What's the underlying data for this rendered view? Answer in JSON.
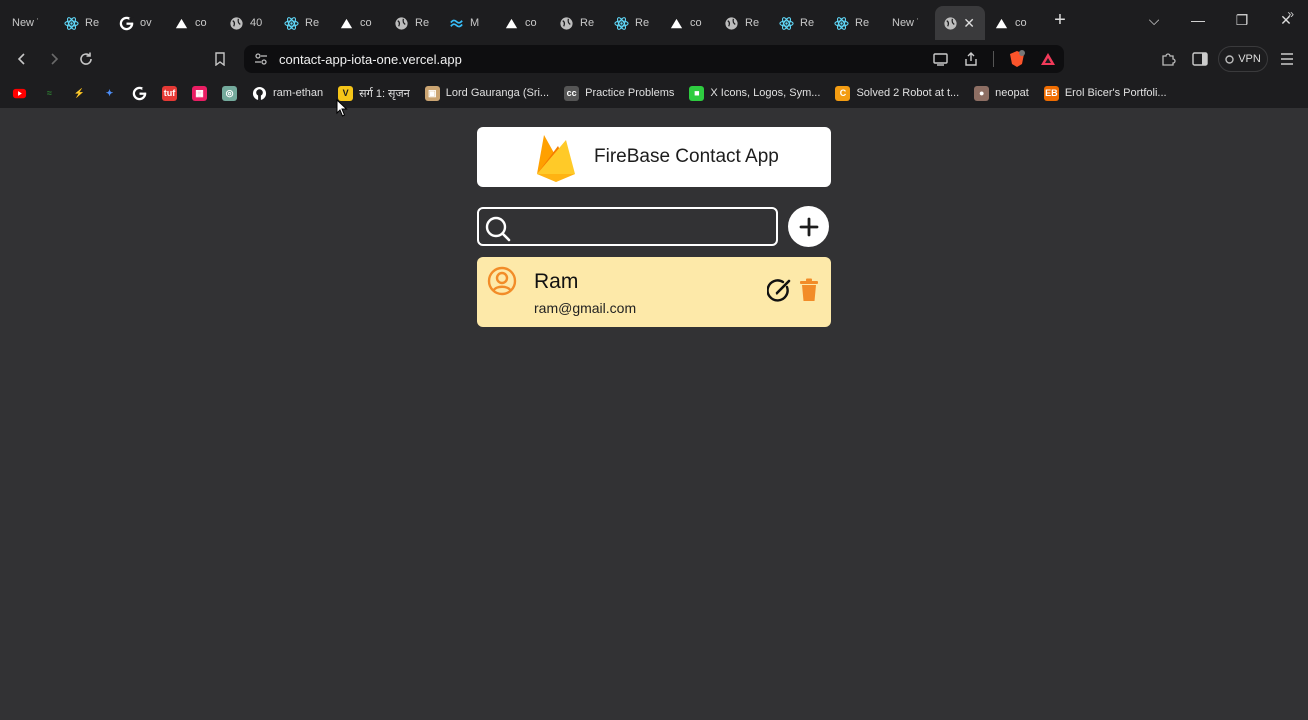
{
  "browser": {
    "tabs": [
      {
        "label": "New Ta",
        "icon": "none"
      },
      {
        "label": "Re",
        "icon": "react-icon"
      },
      {
        "label": "ov",
        "icon": "google-icon"
      },
      {
        "label": "co",
        "icon": "vercel-icon"
      },
      {
        "label": "40",
        "icon": "globe-icon"
      },
      {
        "label": "Re",
        "icon": "react-icon"
      },
      {
        "label": "co",
        "icon": "vercel-icon"
      },
      {
        "label": "Re",
        "icon": "globe-icon"
      },
      {
        "label": "M",
        "icon": "tailwind-icon"
      },
      {
        "label": "co",
        "icon": "vercel-icon"
      },
      {
        "label": "Re",
        "icon": "globe-icon"
      },
      {
        "label": "Re",
        "icon": "react-icon"
      },
      {
        "label": "co",
        "icon": "vercel-icon"
      },
      {
        "label": "Re",
        "icon": "globe-icon"
      },
      {
        "label": "Re",
        "icon": "react-icon"
      },
      {
        "label": "Re",
        "icon": "react-icon"
      },
      {
        "label": "New Ta",
        "icon": "none"
      },
      {
        "label": "",
        "icon": "globe-icon",
        "active": true
      },
      {
        "label": "co",
        "icon": "vercel-icon"
      }
    ],
    "url": "contact-app-iota-one.vercel.app",
    "vpn_label": "VPN",
    "bookmarks": [
      {
        "label": "",
        "icon": "youtube-icon",
        "color": "#ff0000"
      },
      {
        "label": "",
        "icon": "wave-icon",
        "color": "#2e7d32"
      },
      {
        "label": "",
        "icon": "bolt-icon",
        "color": "#f5c518"
      },
      {
        "label": "",
        "icon": "sparkle-icon",
        "color": "#4c8df6"
      },
      {
        "label": "",
        "icon": "google-icon",
        "color": "#4285f4"
      },
      {
        "label": "",
        "icon": "tuf-icon",
        "color": "#e53935"
      },
      {
        "label": "",
        "icon": "grid-icon",
        "color": "#e91e63"
      },
      {
        "label": "",
        "icon": "chatgpt-icon",
        "color": "#74aa9c"
      },
      {
        "label": "ram-ethan",
        "icon": "github-icon",
        "color": "#ffffff"
      },
      {
        "label": "सर्ग 1: सृजन",
        "icon": "v-icon",
        "color": "#f5c518"
      },
      {
        "label": "Lord Gauranga (Sri...",
        "icon": "image-icon",
        "color": "#caa472"
      },
      {
        "label": "Practice Problems",
        "icon": "cc-icon",
        "color": "#555555"
      },
      {
        "label": "X Icons, Logos, Sym...",
        "icon": "square-icon",
        "color": "#2ecc40"
      },
      {
        "label": "Solved 2 Robot at t...",
        "icon": "c-icon",
        "color": "#f39c12"
      },
      {
        "label": "neopat",
        "icon": "neopat-icon",
        "color": "#8d6e63"
      },
      {
        "label": "Erol Bicer's Portfoli...",
        "icon": "eb-icon",
        "color": "#ef6c00"
      }
    ]
  },
  "app": {
    "title": "FireBase Contact App",
    "search_placeholder": "",
    "contacts": [
      {
        "name": "Ram",
        "email": "ram@gmail.com"
      }
    ]
  },
  "colors": {
    "page_bg": "#323234",
    "card_bg": "#fde9a9",
    "accent_orange": "#f28c28",
    "firebase_yellow": "#ffca28"
  }
}
